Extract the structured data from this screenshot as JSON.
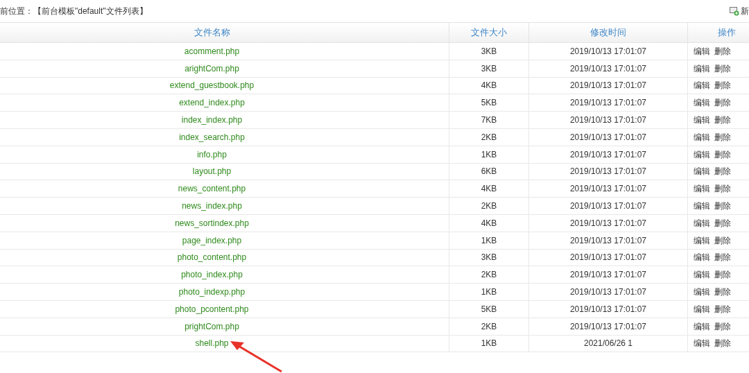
{
  "breadcrumb": "前位置：【前台模板\"default\"文件列表】",
  "new_button": {
    "label": "新"
  },
  "table": {
    "columns": [
      "文件名称",
      "文件大小",
      "修改时间",
      "操作"
    ],
    "rows": [
      {
        "name": "acomment.php",
        "size": "3KB",
        "modified": "2019/10/13 17:01:07",
        "actions": [
          "编辑",
          "删除"
        ]
      },
      {
        "name": "arightCom.php",
        "size": "3KB",
        "modified": "2019/10/13 17:01:07",
        "actions": [
          "编辑",
          "删除"
        ]
      },
      {
        "name": "extend_guestbook.php",
        "size": "4KB",
        "modified": "2019/10/13 17:01:07",
        "actions": [
          "编辑",
          "删除"
        ]
      },
      {
        "name": "extend_index.php",
        "size": "5KB",
        "modified": "2019/10/13 17:01:07",
        "actions": [
          "编辑",
          "删除"
        ]
      },
      {
        "name": "index_index.php",
        "size": "7KB",
        "modified": "2019/10/13 17:01:07",
        "actions": [
          "编辑",
          "删除"
        ]
      },
      {
        "name": "index_search.php",
        "size": "2KB",
        "modified": "2019/10/13 17:01:07",
        "actions": [
          "编辑",
          "删除"
        ]
      },
      {
        "name": "info.php",
        "size": "1KB",
        "modified": "2019/10/13 17:01:07",
        "actions": [
          "编辑",
          "删除"
        ]
      },
      {
        "name": "layout.php",
        "size": "6KB",
        "modified": "2019/10/13 17:01:07",
        "actions": [
          "编辑",
          "删除"
        ]
      },
      {
        "name": "news_content.php",
        "size": "4KB",
        "modified": "2019/10/13 17:01:07",
        "actions": [
          "编辑",
          "删除"
        ]
      },
      {
        "name": "news_index.php",
        "size": "2KB",
        "modified": "2019/10/13 17:01:07",
        "actions": [
          "编辑",
          "删除"
        ]
      },
      {
        "name": "news_sortindex.php",
        "size": "4KB",
        "modified": "2019/10/13 17:01:07",
        "actions": [
          "编辑",
          "删除"
        ]
      },
      {
        "name": "page_index.php",
        "size": "1KB",
        "modified": "2019/10/13 17:01:07",
        "actions": [
          "编辑",
          "删除"
        ]
      },
      {
        "name": "photo_content.php",
        "size": "3KB",
        "modified": "2019/10/13 17:01:07",
        "actions": [
          "编辑",
          "删除"
        ]
      },
      {
        "name": "photo_index.php",
        "size": "2KB",
        "modified": "2019/10/13 17:01:07",
        "actions": [
          "编辑",
          "删除"
        ]
      },
      {
        "name": "photo_indexp.php",
        "size": "1KB",
        "modified": "2019/10/13 17:01:07",
        "actions": [
          "编辑",
          "删除"
        ]
      },
      {
        "name": "photo_pcontent.php",
        "size": "5KB",
        "modified": "2019/10/13 17:01:07",
        "actions": [
          "编辑",
          "删除"
        ]
      },
      {
        "name": "prightCom.php",
        "size": "2KB",
        "modified": "2019/10/13 17:01:07",
        "actions": [
          "编辑",
          "删除"
        ]
      },
      {
        "name": "shell.php",
        "size": "1KB",
        "modified": "2021/06/26 1",
        "actions": [
          "编辑",
          "删除"
        ]
      }
    ]
  }
}
